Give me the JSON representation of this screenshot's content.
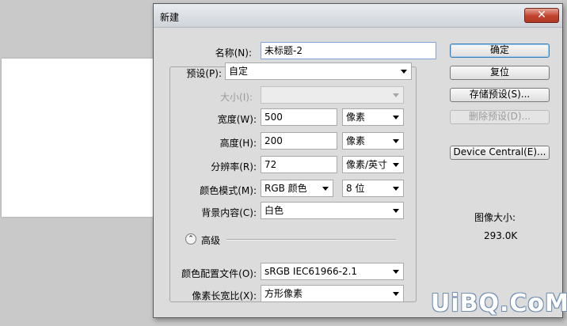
{
  "dialog": {
    "title": "新建",
    "close_label": "✕"
  },
  "form": {
    "name": {
      "label": "名称(N):",
      "value": "未标题-2"
    },
    "preset": {
      "label": "预设(P):",
      "value": "自定"
    },
    "size": {
      "label": "大小(I):",
      "value": ""
    },
    "width": {
      "label": "宽度(W):",
      "value": "500",
      "unit": "像素"
    },
    "height": {
      "label": "高度(H):",
      "value": "200",
      "unit": "像素"
    },
    "resolution": {
      "label": "分辨率(R):",
      "value": "72",
      "unit": "像素/英寸"
    },
    "color_mode": {
      "label": "颜色模式(M):",
      "value": "RGB 颜色",
      "depth": "8 位"
    },
    "background": {
      "label": "背景内容(C):",
      "value": "白色"
    },
    "advanced": {
      "label": "高级",
      "toggle": "⌃"
    },
    "color_profile": {
      "label": "颜色配置文件(O):",
      "value": "sRGB IEC61966-2.1"
    },
    "pixel_aspect": {
      "label": "像素长宽比(X):",
      "value": "方形像素"
    }
  },
  "buttons": {
    "ok": "确定",
    "reset": "复位",
    "save_preset": "存储预设(S)...",
    "delete_preset": "删除预设(D)...",
    "device_central": "Device Central(E)..."
  },
  "image_size": {
    "label": "图像大小:",
    "value": "293.0K"
  },
  "watermark": "UiBQ.CoM"
}
